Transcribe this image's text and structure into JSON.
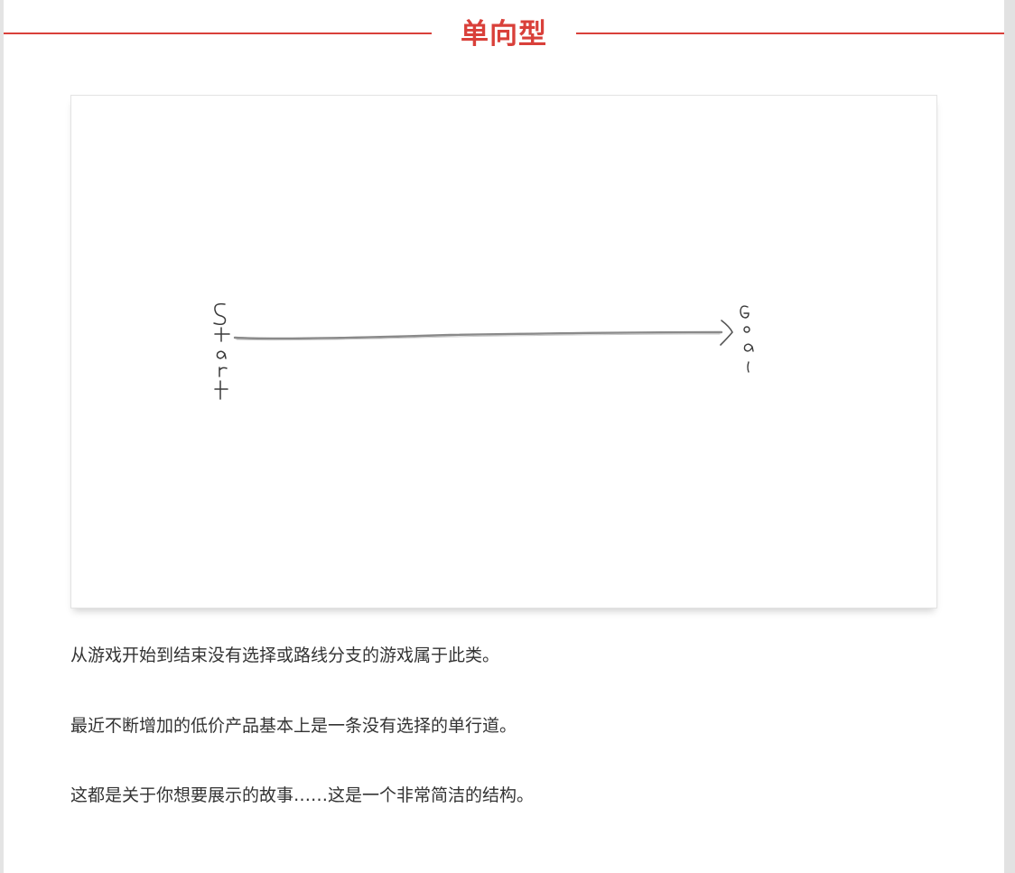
{
  "section": {
    "title": "单向型",
    "accent_color": "#d9403a"
  },
  "figure": {
    "start_label": "Start",
    "goal_label": "Goal",
    "start_letters": [
      "S",
      "t",
      "a",
      "r",
      "t"
    ],
    "goal_letters": [
      "G",
      "o",
      "a",
      "l"
    ]
  },
  "paragraphs": [
    "从游戏开始到结束没有选择或路线分支的游戏属于此类。",
    "最近不断增加的低价产品基本上是一条没有选择的单行道。",
    "这都是关于你想要展示的故事……这是一个非常简洁的结构。"
  ]
}
